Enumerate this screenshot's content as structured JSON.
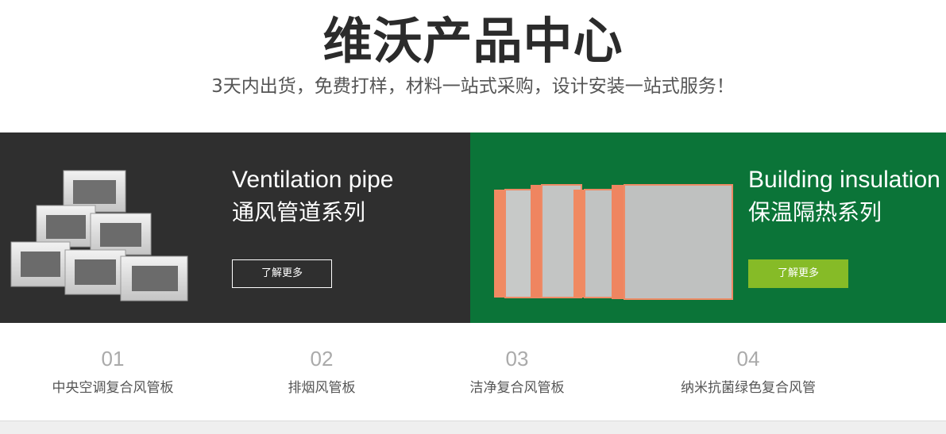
{
  "header": {
    "title": "维沃产品中心",
    "subtitle": "3天内出货，免费打样，材料一站式采购，设计安装一站式服务！"
  },
  "banners": {
    "ventilation": {
      "title_en": "Ventilation pipe",
      "title_cn": "通风管道系列",
      "button_label": "了解更多",
      "bg_color": "#2f2f2f"
    },
    "insulation": {
      "title_en": "Building insulation",
      "title_cn": "保温隔热系列",
      "button_label": "了解更多",
      "bg_color": "#0b7438",
      "button_color": "#86bb27"
    }
  },
  "categories": [
    {
      "num": "01",
      "name": "中央空调复合风管板"
    },
    {
      "num": "02",
      "name": "排烟风管板"
    },
    {
      "num": "03",
      "name": "洁净复合风管板"
    },
    {
      "num": "04",
      "name": "纳米抗菌绿色复合风管"
    }
  ],
  "icons": {
    "duct": "duct-stack-icon",
    "panel": "insulation-panels-icon"
  }
}
